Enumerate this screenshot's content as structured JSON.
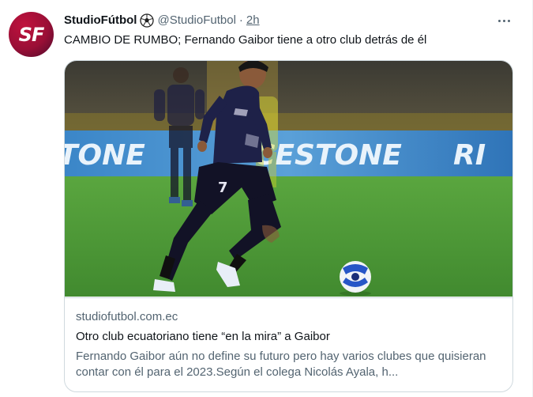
{
  "tweet": {
    "avatar_text": "SF",
    "display_name": "StudioFútbol",
    "emoji": "soccer-ball-icon",
    "handle": "@StudioFutbol",
    "separator": "·",
    "time": "2h",
    "text": "CAMBIO DE RUMBO; Fernando Gaibor tiene a otro club detrás de él"
  },
  "card": {
    "image": {
      "banner_left": "TONE",
      "banner_mid": "CESTONE",
      "banner_right": "RI",
      "jersey_number": "7"
    },
    "domain": "studiofutbol.com.ec",
    "title": "Otro club ecuatoriano tiene “en la mira” a Gaibor",
    "description": "Fernando Gaibor aún no define su futuro pero hay varios clubes que quisieran contar con él para el 2023.Según el colega Nicolás Ayala, h..."
  },
  "colors": {
    "avatar": "#9a0f36",
    "secondary_text": "#536471",
    "border": "#cfd9de",
    "pitch": "#4f9b3a"
  }
}
